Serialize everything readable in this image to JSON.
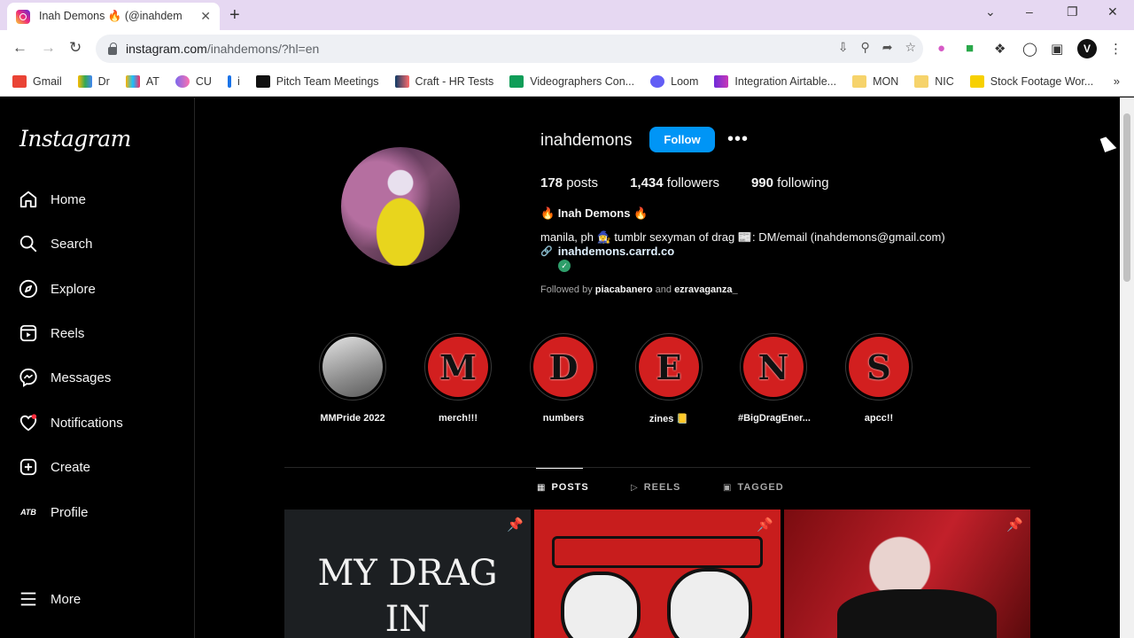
{
  "browser": {
    "tab_title": "Inah Demons 🔥 (@inahdem",
    "tab_close": "✕",
    "new_tab": "+",
    "url_host": "instagram.com",
    "url_rest": "/inahdemons/?hl=en",
    "profile_initial": "V",
    "bookmarks": [
      "Gmail",
      "Dr",
      "AT",
      "CU",
      "i",
      "Pitch Team Meetings",
      "Craft - HR Tests",
      "Videographers Con...",
      "Loom",
      "Integration Airtable...",
      "MON",
      "NIC",
      "Stock Footage Wor..."
    ],
    "bookmarks_more": "»"
  },
  "instagram": {
    "logo": "Instagram",
    "nav": [
      "Home",
      "Search",
      "Explore",
      "Reels",
      "Messages",
      "Notifications",
      "Create",
      "Profile"
    ],
    "nav_more": "More",
    "profile_nav_badge": "ATB"
  },
  "profile": {
    "username": "inahdemons",
    "follow_label": "Follow",
    "more_label": "•••",
    "posts_count": "178",
    "posts_label": "posts",
    "followers_count": "1,434",
    "followers_label": "followers",
    "following_count": "990",
    "following_label": "following",
    "display_name": "🔥 Inah Demons 🔥",
    "bio": "manila, ph 🧙‍♀️ tumblr sexyman of drag 📰: DM/email (inahdemons@gmail.com)",
    "link": "inahdemons.carrd.co",
    "verified_mark": "✓",
    "followed_by_prefix": "Followed by",
    "followed_by_1": "piacabanero",
    "followed_by_and": "and",
    "followed_by_2": "ezravaganza_"
  },
  "highlights": [
    {
      "label": "MMPride 2022",
      "letter": ""
    },
    {
      "label": "merch!!!",
      "letter": "M"
    },
    {
      "label": "numbers",
      "letter": "D"
    },
    {
      "label": "zines 📒",
      "letter": "E"
    },
    {
      "label": "#BigDragEner...",
      "letter": "N"
    },
    {
      "label": "apcc!!",
      "letter": "S"
    }
  ],
  "tabs": {
    "posts": "POSTS",
    "reels": "REELS",
    "tagged": "TAGGED"
  },
  "posts": {
    "first_text_line1": "MY DRAG",
    "first_text_line2": "IN"
  },
  "colors": {
    "follow_button": "#0095f6",
    "highlight_red": "#d21f1f",
    "background": "#000000"
  }
}
